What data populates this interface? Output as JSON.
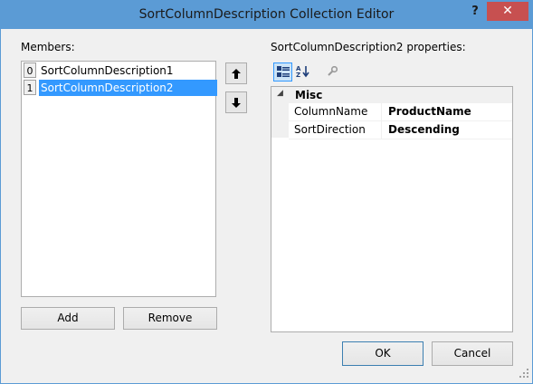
{
  "window": {
    "title": "SortColumnDescription Collection Editor",
    "help_glyph": "?",
    "close_glyph": "✕",
    "title_bar_color": "#5b9bd5",
    "close_button_color": "#c75050",
    "selection_color": "#3399ff"
  },
  "members": {
    "label": "Members:",
    "items": [
      {
        "index": "0",
        "name": "SortColumnDescription1",
        "selected": false
      },
      {
        "index": "1",
        "name": "SortColumnDescription2",
        "selected": true
      }
    ],
    "move_up_icon": "arrow-up-icon",
    "move_down_icon": "arrow-down-icon",
    "add_label": "Add",
    "remove_label": "Remove"
  },
  "properties": {
    "label": "SortColumnDescription2 properties:",
    "toolbar": [
      {
        "icon": "categorized-icon",
        "active": true
      },
      {
        "icon": "alphabetical-icon",
        "active": false
      },
      {
        "icon": "property-pages-icon",
        "active": false
      }
    ],
    "category": "Misc",
    "rows": [
      {
        "name": "ColumnName",
        "value": "ProductName"
      },
      {
        "name": "SortDirection",
        "value": "Descending"
      }
    ]
  },
  "footer": {
    "ok_label": "OK",
    "cancel_label": "Cancel"
  }
}
